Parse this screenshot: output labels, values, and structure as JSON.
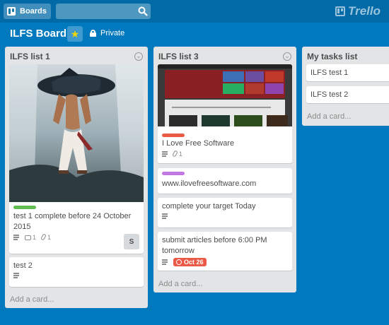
{
  "header": {
    "boards_label": "Boards",
    "search_value": "",
    "logo_text": "Trello"
  },
  "board": {
    "title": "ILFS Board",
    "visibility": "Private"
  },
  "lists": [
    {
      "title": "ILFS list 1",
      "cards": [
        {
          "title": "test 1 complete before 24 October 2015",
          "label_color": "#61bd4f",
          "has_description": true,
          "comments": "1",
          "attachments": "1",
          "member_initial": "S",
          "has_cover": true
        },
        {
          "title": "test 2",
          "has_description": true
        }
      ],
      "add_card_label": "Add a card..."
    },
    {
      "title": "ILFS list 3",
      "cards": [
        {
          "title": "I Love Free Software",
          "label_color": "#eb5a46",
          "has_description": true,
          "attachments": "1",
          "has_cover": true
        },
        {
          "title": "www.ilovefreesoftware.com",
          "label_color": "#c377e0"
        },
        {
          "title": "complete your target Today",
          "has_description": true
        },
        {
          "title": "submit articles before 6:00 PM tomorrow",
          "has_description": true,
          "due": "Oct 26"
        }
      ],
      "add_card_label": "Add a card..."
    },
    {
      "title": "My tasks list",
      "cards": [
        {
          "title": "ILFS test 1"
        },
        {
          "title": "ILFS test 2"
        }
      ],
      "add_card_label": "Add a card..."
    }
  ],
  "colors": {
    "board_bg": "#0079bf",
    "header_bg": "#026aa7",
    "list_bg": "#e2e4e6",
    "label_green": "#61bd4f",
    "label_red": "#eb5a46",
    "label_purple": "#c377e0",
    "due_red": "#eb5a46"
  }
}
